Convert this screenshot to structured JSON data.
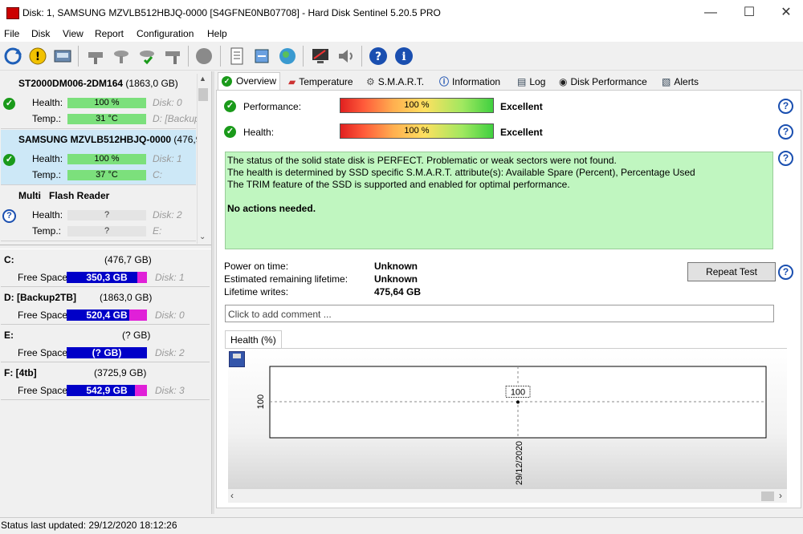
{
  "window": {
    "title": "Disk: 1, SAMSUNG MZVLB512HBJQ-0000 [S4GFNE0NB07708]  -  Hard Disk Sentinel 5.20.5 PRO",
    "minimize": "—",
    "maximize": "☐",
    "close": "✕"
  },
  "menu": {
    "file": "File",
    "disk": "Disk",
    "view": "View",
    "report": "Report",
    "configuration": "Configuration",
    "help": "Help"
  },
  "disks": [
    {
      "name": "ST2000DM006-2DM164",
      "size": "(1863,0 GB)",
      "health_label": "Health:",
      "health": "100 %",
      "temp_label": "Temp.:",
      "temp": "31 °C",
      "disk_no": "Disk: 0",
      "drive": "D: [Backup"
    },
    {
      "name": "SAMSUNG MZVLB512HBJQ-0000",
      "size": "(476,9",
      "health_label": "Health:",
      "health": "100 %",
      "temp_label": "Temp.:",
      "temp": "37 °C",
      "disk_no": "Disk: 1",
      "drive": "C:"
    },
    {
      "name": "Multi   Flash Reader",
      "size": "",
      "health_label": "Health:",
      "health": "?",
      "temp_label": "Temp.:",
      "temp": "?",
      "disk_no": "Disk: 2",
      "drive": "E:"
    }
  ],
  "volumes": [
    {
      "name": "C:",
      "size": "(476,7 GB)",
      "free_label": "Free Space",
      "free": "350,3 GB",
      "disk_no": "Disk: 1",
      "free_fraction": 0.73
    },
    {
      "name": "D: [Backup2TB]",
      "size": "(1863,0 GB)",
      "free_label": "Free Space",
      "free": "520,4 GB",
      "disk_no": "Disk: 0",
      "free_fraction": 0.72
    },
    {
      "name": "E:",
      "size": "(? GB)",
      "free_label": "Free Space",
      "free": "(? GB)",
      "disk_no": "Disk: 2",
      "free_fraction": 1.0
    },
    {
      "name": "F: [4tb]",
      "size": "(3725,9 GB)",
      "free_label": "Free Space",
      "free": "542,9 GB",
      "disk_no": "Disk: 3",
      "free_fraction": 0.85
    }
  ],
  "tabs": {
    "overview": "Overview",
    "temperature": "Temperature",
    "smart": "S.M.A.R.T.",
    "information": "Information",
    "log": "Log",
    "disk_performance": "Disk Performance",
    "alerts": "Alerts"
  },
  "overview": {
    "performance_label": "Performance:",
    "performance_value": "100 %",
    "performance_rating": "Excellent",
    "health_label": "Health:",
    "health_value": "100 %",
    "health_rating": "Excellent",
    "status_line1": "The status of the solid state disk is PERFECT. Problematic or weak sectors were not found.",
    "status_line2": "The health is determined by SSD specific S.M.A.R.T. attribute(s):  Available Spare (Percent), Percentage Used",
    "status_line3": "The TRIM feature of the SSD is supported and enabled for optimal performance.",
    "status_action": "No actions needed.",
    "power_on_label": "Power on time:",
    "power_on_value": "Unknown",
    "remaining_label": "Estimated remaining lifetime:",
    "remaining_value": "Unknown",
    "writes_label": "Lifetime writes:",
    "writes_value": "475,64 GB",
    "repeat_button": "Repeat Test",
    "comment_placeholder": "Click to add comment ...",
    "health_tab": "Health (%)"
  },
  "chart_data": {
    "type": "line",
    "x": [
      "29/12/2020"
    ],
    "series": [
      {
        "values": [
          100
        ]
      }
    ],
    "data_labels": [
      "100"
    ],
    "ylabel_tick": "100",
    "xlabel": "",
    "ylabel": ""
  },
  "status": {
    "text": "Status last updated: 29/12/2020 18:12:26"
  },
  "colors": {
    "health_green": "#7ce07c",
    "free_space_blue": "#0000c8",
    "used_space_pink": "#e020d8",
    "status_green_bg": "#c0f6c0",
    "selected_bg": "#cde8f7"
  }
}
